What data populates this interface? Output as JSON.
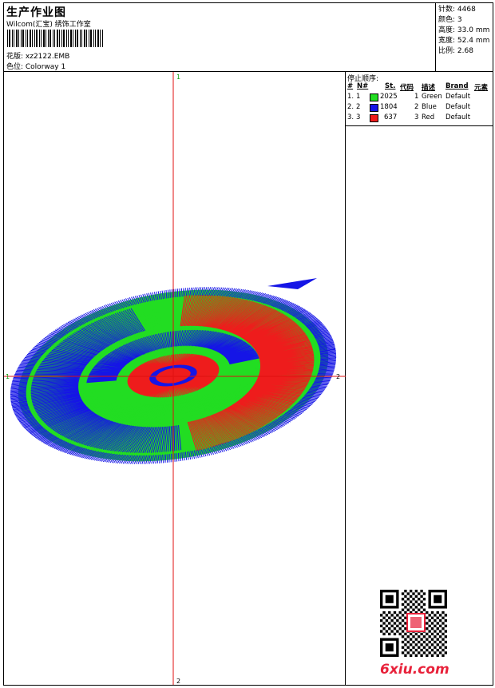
{
  "header": {
    "title": "生产作业图",
    "subtitle": "Wilcom(汇宝) 绣饰工作室",
    "design_label": "花版: xz2122.EMB",
    "colorway_label": "色位:  Colorway 1"
  },
  "stats": [
    {
      "label": "针数:",
      "value": "4468"
    },
    {
      "label": "颜色:",
      "value": "3"
    },
    {
      "label": "高度:",
      "value": "33.0 mm"
    },
    {
      "label": "宽度:",
      "value": "52.4 mm"
    },
    {
      "label": "比例:",
      "value": "2.68"
    }
  ],
  "legend": {
    "title": "停止顺序:",
    "columns": [
      "#",
      "N#",
      "St.",
      "代码",
      "描述",
      "Brand",
      "元素"
    ],
    "rows": [
      {
        "index": "1.",
        "n": "1",
        "stitches": "2025",
        "code": "1",
        "desc": "Green",
        "brand": "Default",
        "color": "#22dd22"
      },
      {
        "index": "2.",
        "n": "2",
        "stitches": "1804",
        "code": "2",
        "desc": "Blue",
        "brand": "Default",
        "color": "#1515e6"
      },
      {
        "index": "3.",
        "n": "3",
        "stitches": "637",
        "code": "3",
        "desc": "Red",
        "brand": "Default",
        "color": "#ee1c1c"
      }
    ]
  },
  "canvas": {
    "axis_marks": {
      "top": "1",
      "bottom": "2",
      "left": "1",
      "right": "2"
    },
    "colors": {
      "green": "#22dd22",
      "blue": "#1515e6",
      "red": "#ee1c1c",
      "axis": "#e01010"
    }
  },
  "watermark": {
    "text": "6xiu.com"
  }
}
